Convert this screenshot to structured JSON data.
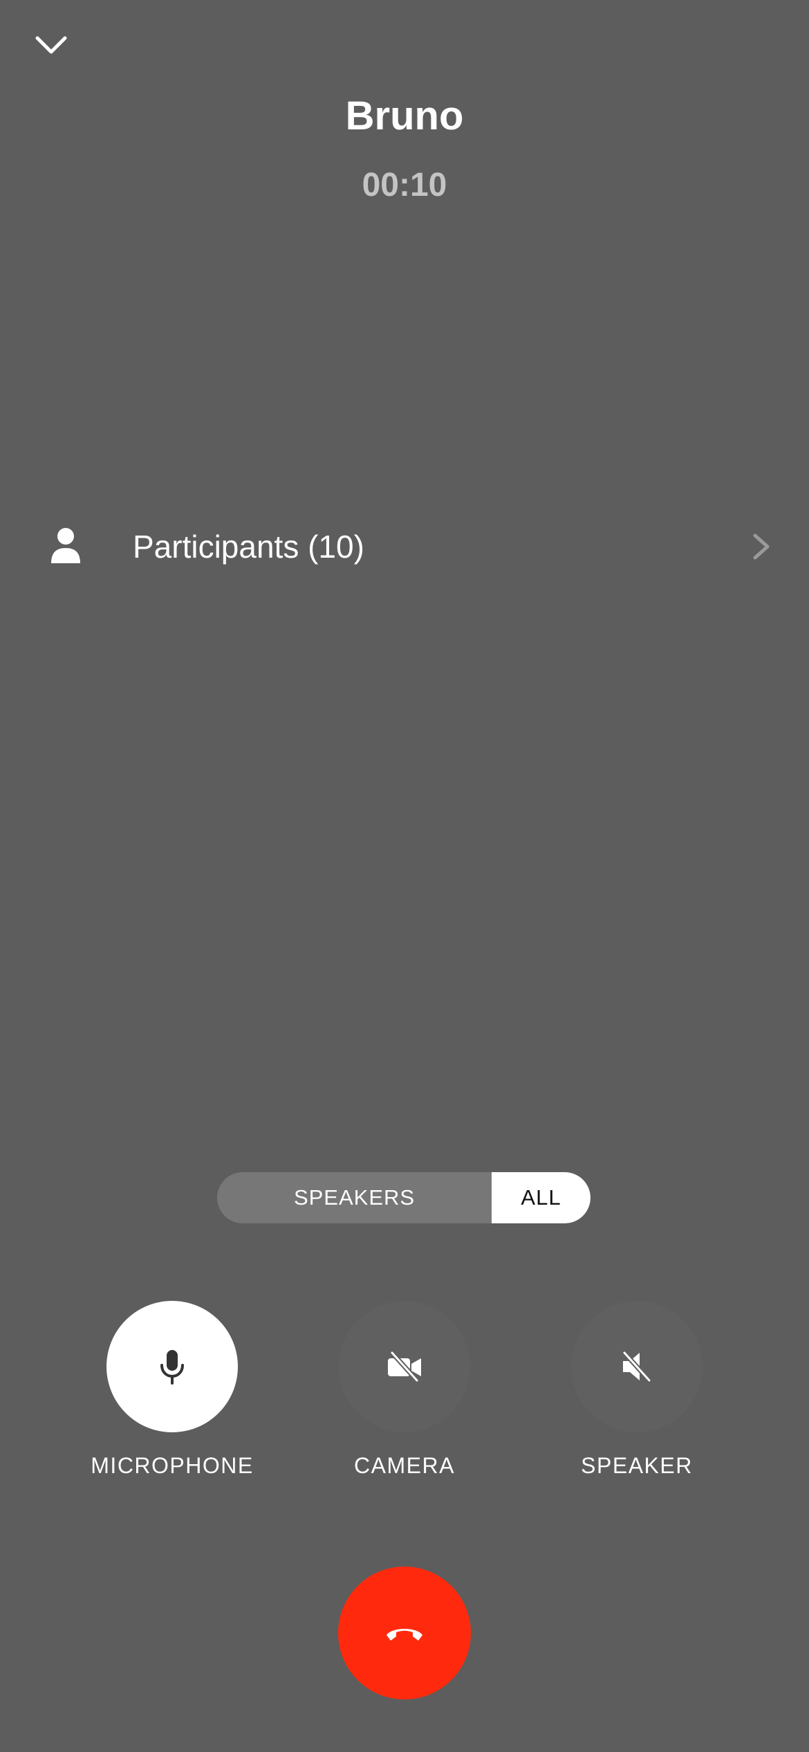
{
  "header": {
    "collapse_icon": "chevron-down-icon",
    "caller_name": "Bruno",
    "call_timer": "00:10"
  },
  "participants": {
    "icon": "person-icon",
    "label": "Participants (10)",
    "chevron_icon": "chevron-right-icon"
  },
  "view_toggle": {
    "speakers_label": "SPEAKERS",
    "all_label": "ALL",
    "selected": "ALL"
  },
  "controls": {
    "microphone": {
      "label": "MICROPHONE",
      "icon": "microphone-icon",
      "state": "on"
    },
    "camera": {
      "label": "CAMERA",
      "icon": "camera-off-icon",
      "state": "off"
    },
    "speaker": {
      "label": "SPEAKER",
      "icon": "speaker-muted-icon",
      "state": "off"
    }
  },
  "end_call": {
    "icon": "hang-up-icon"
  },
  "colors": {
    "background": "#5d5d5d",
    "end_call": "#ff2a0d",
    "toggle_track": "#777777",
    "toggle_selected": "#ffffff",
    "timer_text": "#c4c4c4"
  }
}
